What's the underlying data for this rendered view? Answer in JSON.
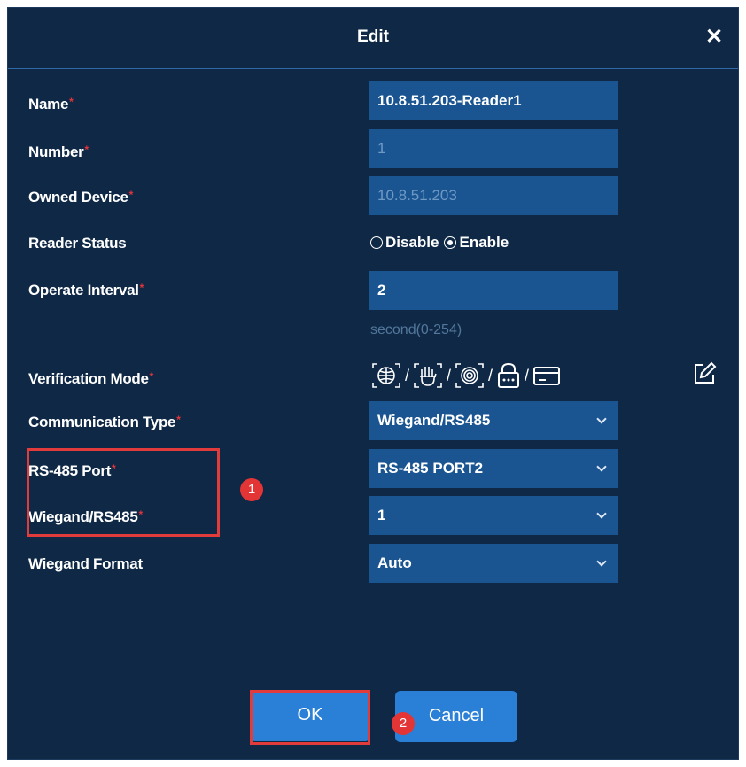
{
  "dialog": {
    "title": "Edit"
  },
  "fields": {
    "name": {
      "label": "Name",
      "value": "10.8.51.203-Reader1"
    },
    "number": {
      "label": "Number",
      "value": "1"
    },
    "owned_device": {
      "label": "Owned Device",
      "value": "10.8.51.203"
    },
    "reader_status": {
      "label": "Reader Status",
      "options": [
        "Disable",
        "Enable"
      ],
      "selected": "Enable"
    },
    "operate_interval": {
      "label": "Operate Interval",
      "value": "2",
      "hint": "second(0-254)"
    },
    "verification_mode": {
      "label": "Verification Mode",
      "separator": "/",
      "icons": [
        "face-icon",
        "palm-icon",
        "fingerprint-icon",
        "password-icon",
        "card-icon"
      ]
    },
    "communication_type": {
      "label": "Communication Type",
      "value": "Wiegand/RS485"
    },
    "rs485_port": {
      "label": "RS-485 Port",
      "value": "RS-485 PORT2"
    },
    "wiegand_rs485": {
      "label": "Wiegand/RS485",
      "value": "1"
    },
    "wiegand_format": {
      "label": "Wiegand Format",
      "value": "Auto"
    }
  },
  "required_mark": "*",
  "buttons": {
    "ok": "OK",
    "cancel": "Cancel"
  },
  "annotations": {
    "badge1": "1",
    "badge2": "2"
  },
  "colors": {
    "background": "#0e2846",
    "field": "#1a5592",
    "button": "#2a7fd6",
    "annotation": "#e23b3b"
  }
}
